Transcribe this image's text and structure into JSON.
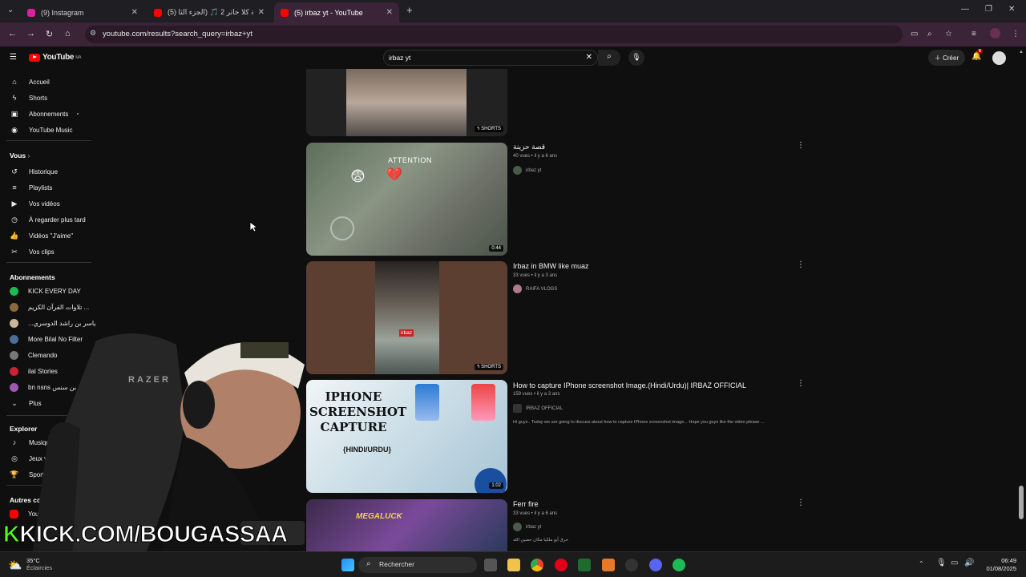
{
  "browser": {
    "tabs": [
      {
        "label": "(9) Instagram",
        "color": "#d6249f"
      },
      {
        "label": "(5) أغنية كلا خاتر 2 🎵 (الجزء الثا...",
        "color": "#ff0000"
      },
      {
        "label": "(5) irbaz yt - YouTube",
        "color": "#ff0000"
      }
    ],
    "url": "youtube.com/results?search_query=irbaz+yt",
    "new_tab": "+",
    "minimize": "—",
    "maximize": "❐",
    "close": "✕"
  },
  "youtube": {
    "logo": "YouTube",
    "region": "MA",
    "search_value": "irbaz yt",
    "create_label": "Créer",
    "notif_count": "9"
  },
  "sidebar": {
    "main": [
      {
        "label": "Accueil",
        "icon": "home-icon"
      },
      {
        "label": "Shorts",
        "icon": "shorts-icon"
      },
      {
        "label": "Abonnements",
        "icon": "subscriptions-icon"
      },
      {
        "label": "YouTube Music",
        "icon": "music-icon"
      }
    ],
    "you_title": "Vous",
    "you": [
      {
        "label": "Historique"
      },
      {
        "label": "Playlists"
      },
      {
        "label": "Vos vidéos"
      },
      {
        "label": "À regarder plus tard"
      },
      {
        "label": "Vidéos \"J'aime\""
      },
      {
        "label": "Vos clips"
      }
    ],
    "subs_title": "Abonnements",
    "subs": [
      {
        "label": "KICK EVERY DAY",
        "color": "#1db954"
      },
      {
        "label": "تلاوات القرآن الكريم ...",
        "color": "#8a6a3a"
      },
      {
        "label": "...ياسر بن راشد الدوسري",
        "color": "#c9b79a"
      },
      {
        "label": "More Bilal No Filter",
        "color": "#4a6f9a"
      },
      {
        "label": "Clemando",
        "color": "#777"
      },
      {
        "label": "ilal Stories",
        "color": "#c23"
      },
      {
        "label": "bn nsns بن سنس",
        "color": "#9a5ab0"
      },
      {
        "label": "Plus",
        "color": ""
      }
    ],
    "explore_title": "Explorer",
    "explore": [
      {
        "label": "Musique"
      },
      {
        "label": "Jeux vidéo"
      },
      {
        "label": "Sport"
      }
    ],
    "other_title": "Autres contenus",
    "other": [
      {
        "label": "YouTube Premium"
      }
    ]
  },
  "videos": [
    {
      "title": "",
      "meta": "",
      "channel": "",
      "desc": "",
      "badge": "SHORTS"
    },
    {
      "title": "قصة حزينة",
      "meta": "40 vues • il y a 6 ans",
      "channel": "irbaz yt",
      "desc": "",
      "badge": "0:44",
      "thumb_text": "ATTENTION"
    },
    {
      "title": "Irbaz in BMW like muaz",
      "meta": "33 vues • il y a 3 ans",
      "channel": "RAIFA VLOGS",
      "desc": "",
      "badge": "SHORTS",
      "thumb_text": "irbaz"
    },
    {
      "title": "How to capture IPhone screenshot Image.(Hindi/Urdu)| IRBAZ OFFICIAL",
      "meta": "159 vues • il y a 3 ans",
      "channel": "IRBAZ OFFICIAL",
      "desc": "Hi guys.. Today we are going to discuss about how to capture IPhone screenshot image... Hope you guys like the video please ...",
      "badge": "1:02",
      "thumb_text": "IPHONE SCREENSHOT CAPTURE",
      "thumb_sub": "{HINDI/URDU}"
    },
    {
      "title": "Ferr fire",
      "meta": "33 vues • il y a 6 ans",
      "channel": "irbaz yt",
      "desc": "حرق أيو ملكيا مكان حصين الله",
      "badge": "",
      "thumb_text": "MEGALUCK"
    }
  ],
  "overlay": {
    "kick_prefix": "K",
    "kick_rest": "KICK.COM/BOUGASSAA",
    "razer": "RAZER"
  },
  "taskbar": {
    "temp": "35°C",
    "weather": "Éclaircies",
    "search_placeholder": "Rechercher",
    "time": "06:49",
    "date": "01/08/2025"
  }
}
